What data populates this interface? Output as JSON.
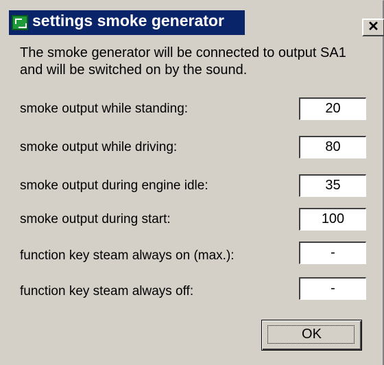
{
  "window": {
    "title": "settings smoke generator",
    "close_label": "✕",
    "title_icon": "app-icon"
  },
  "intro": {
    "line1": "The smoke generator will be connected to output SA1",
    "line2": "and will be switched on by the sound."
  },
  "rows": [
    {
      "label": "smoke output while standing:",
      "value": "20"
    },
    {
      "label": "smoke output while driving:",
      "value": "80"
    },
    {
      "label": "smoke output during engine idle:",
      "value": "35"
    },
    {
      "label": "smoke output during start:",
      "value": "100"
    },
    {
      "label": "function key steam always on (max.):",
      "value": "-"
    },
    {
      "label": "function key steam always off:",
      "value": "-"
    }
  ],
  "buttons": {
    "ok_label": "OK"
  }
}
